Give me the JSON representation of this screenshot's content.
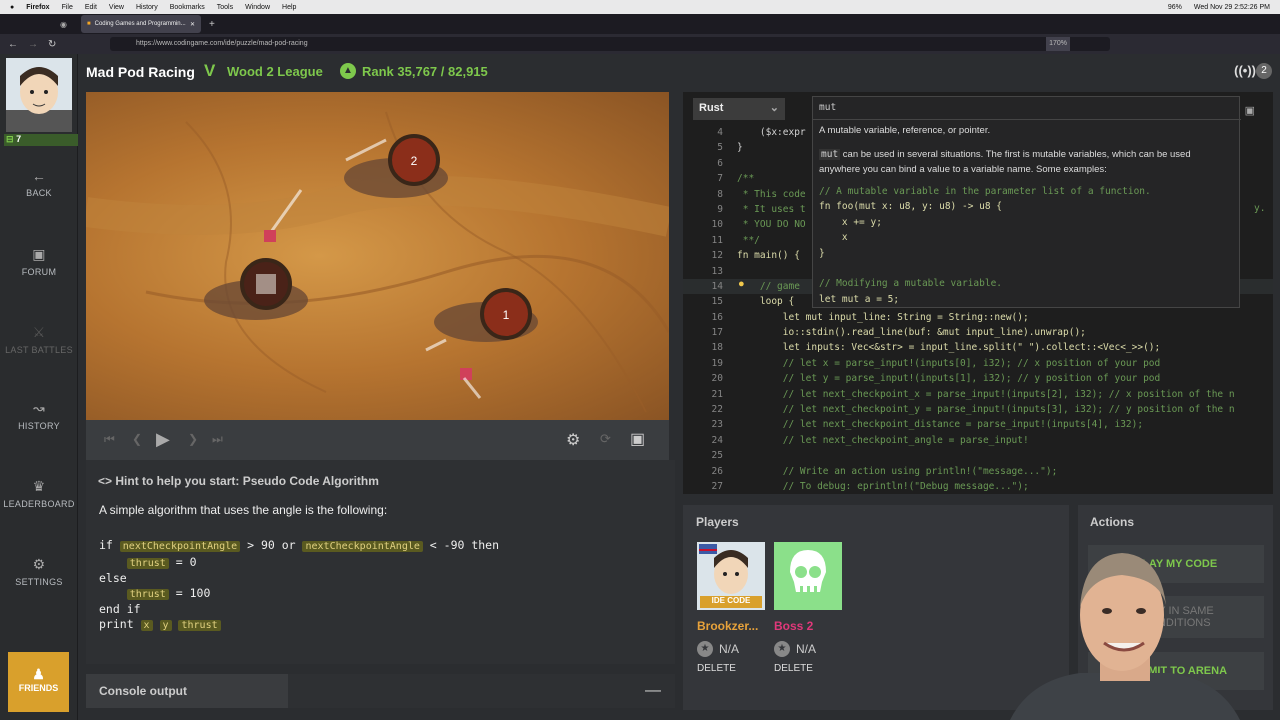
{
  "menubar": {
    "app": "Firefox",
    "items": [
      "File",
      "Edit",
      "View",
      "History",
      "Bookmarks",
      "Tools",
      "Window",
      "Help"
    ],
    "clock": "Wed Nov 29  2:52:26 PM",
    "battery": "96%"
  },
  "browser": {
    "tab_title": "Coding Games and Programmin...",
    "url": "https://www.codingame.com/ide/puzzle/mad-pod-racing",
    "zoom": "170%"
  },
  "sidebar": {
    "level": "7",
    "items": [
      "BACK",
      "FORUM",
      "LAST BATTLES",
      "HISTORY",
      "LEADERBOARD",
      "SETTINGS"
    ],
    "friends": "FRIENDS"
  },
  "header": {
    "title": "Mad Pod Racing",
    "league": "Wood 2 League",
    "rank": "Rank 35,767 / 82,915",
    "live_count": "2"
  },
  "game": {
    "checkpoints": [
      "1",
      "2"
    ]
  },
  "hint": {
    "title": "Hint to help you start: Pseudo Code Algorithm",
    "desc": "A simple algorithm that uses the angle is the following:",
    "line1a": "if ",
    "var1": "nextCheckpointAngle",
    "line1b": " > 90 or ",
    "var2": "nextCheckpointAngle",
    "line1c": " < -90 then",
    "v_thrust": "thrust",
    "line2": " = 0",
    "line3": "else",
    "line4": " = 100",
    "line5": "end if",
    "line6": "print ",
    "vx": "x",
    "vy": "y"
  },
  "console": {
    "title": "Console output"
  },
  "editor": {
    "language": "Rust",
    "lines": [
      {
        "n": "4",
        "t": "    ($x:expr"
      },
      {
        "n": "5",
        "t": "}"
      },
      {
        "n": "6",
        "t": ""
      },
      {
        "n": "7",
        "t": "/**"
      },
      {
        "n": "8",
        "t": " * This code"
      },
      {
        "n": "9",
        "t": " * It uses t"
      },
      {
        "n": "10",
        "t": " * YOU DO NO"
      },
      {
        "n": "11",
        "t": " **/"
      },
      {
        "n": "12",
        "t": "fn main() {"
      },
      {
        "n": "13",
        "t": ""
      },
      {
        "n": "14",
        "t": "    // game"
      },
      {
        "n": "15",
        "t": "    loop {"
      },
      {
        "n": "16",
        "t": "        let mut input_line: String = String::new();"
      },
      {
        "n": "17",
        "t": "        io::stdin().read_line(buf: &mut input_line).unwrap();"
      },
      {
        "n": "18",
        "t": "        let inputs: Vec<&str> = input_line.split(\" \").collect::<Vec<_>>();"
      },
      {
        "n": "19",
        "t": "        // let x = parse_input!(inputs[0], i32); // x position of your pod"
      },
      {
        "n": "20",
        "t": "        // let y = parse_input!(inputs[1], i32); // y position of your pod"
      },
      {
        "n": "21",
        "t": "        // let next_checkpoint_x = parse_input!(inputs[2], i32); // x position of the n"
      },
      {
        "n": "22",
        "t": "        // let next_checkpoint_y = parse_input!(inputs[3], i32); // y position of the n"
      },
      {
        "n": "23",
        "t": "        // let next_checkpoint_distance = parse_input!(inputs[4], i32);"
      },
      {
        "n": "24",
        "t": "        // let next_checkpoint_angle = parse_input!"
      },
      {
        "n": "25",
        "t": ""
      },
      {
        "n": "26",
        "t": "        // Write an action using println!(\"message...\");"
      },
      {
        "n": "27",
        "t": "        // To debug: eprintln!(\"Debug message...\");"
      }
    ],
    "trail9": "y.",
    "tooltip": {
      "word": "mut",
      "desc": "A mutable variable, reference, or pointer.",
      "p1a": "mut",
      "p1b": " can be used in several situations. The first is mutable variables, which can be used anywhere you can bind a value to a variable name. Some examples:",
      "code": [
        "// A mutable variable in the parameter list of a function.",
        "fn foo(mut x: u8, y: u8) -> u8 {",
        "    x += y;",
        "    x",
        "}",
        "",
        "// Modifying a mutable variable.",
        "let mut a = 5;"
      ]
    }
  },
  "players": {
    "title": "Players",
    "p1": {
      "name": "Brookzer...",
      "badge": "IDE CODE",
      "score": "N/A",
      "delete": "DELETE"
    },
    "p2": {
      "name": "Boss 2",
      "score": "N/A",
      "delete": "DELETE"
    }
  },
  "actions": {
    "title": "Actions",
    "play": "PLAY MY CODE",
    "same1": "PLAY IN SAME",
    "same2": "CONDITIONS",
    "arena": "SUBMIT TO ARENA"
  }
}
